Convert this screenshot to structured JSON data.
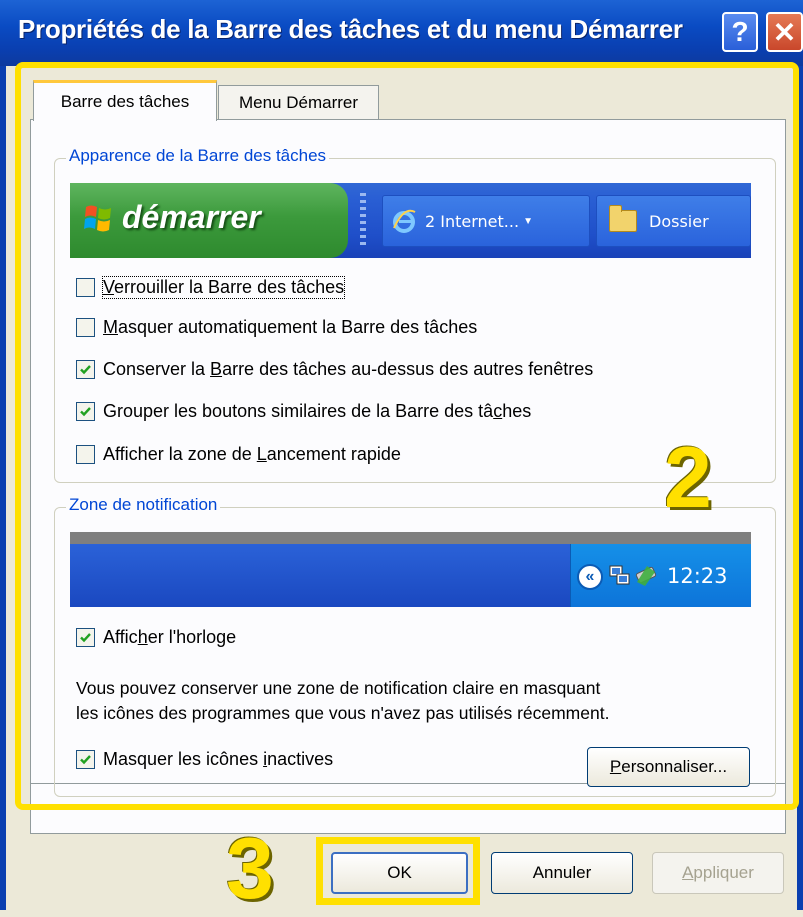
{
  "window": {
    "title": "Propriétés de la Barre des tâches et du menu Démarrer",
    "help_symbol": "?",
    "close_symbol": "✕"
  },
  "tabs": [
    {
      "label": "Barre des tâches",
      "selected": true
    },
    {
      "label": "Menu Démarrer",
      "selected": false
    }
  ],
  "appearance": {
    "legend": "Apparence de la Barre des tâches",
    "preview": {
      "start_label": "démarrer",
      "task_ie_label": "2 Internet...",
      "task_folder_label": "Dossier"
    },
    "options": [
      {
        "pre": "",
        "u": "V",
        "post": "errouiller la Barre des tâches",
        "checked": false
      },
      {
        "pre": "",
        "u": "M",
        "post": "asquer automatiquement la Barre des tâches",
        "checked": false
      },
      {
        "pre": "Conserver la ",
        "u": "B",
        "post": "arre des tâches au-dessus des autres fenêtres",
        "checked": true
      },
      {
        "pre": "Grouper les boutons similaires de la Barre des tâ",
        "u": "c",
        "post": "hes",
        "checked": true
      },
      {
        "pre": "Afficher la zone de ",
        "u": "L",
        "post": "ancement rapide",
        "checked": false
      }
    ]
  },
  "notification": {
    "legend": "Zone de notification",
    "clock_preview": "12:23",
    "show_clock": {
      "pre": "Affic",
      "u": "h",
      "post": "er l'horloge",
      "checked": true
    },
    "description_line1": "Vous pouvez conserver une zone de notification claire en masquant",
    "description_line2": "les icônes des programmes que vous n'avez pas utilisés récemment.",
    "hide_inactive": {
      "pre": "Masquer les icônes ",
      "u": "i",
      "post": "nactives",
      "checked": true
    },
    "customize_button": {
      "u": "P",
      "post": "ersonnaliser..."
    }
  },
  "buttons": {
    "ok": "OK",
    "cancel": "Annuler",
    "apply": {
      "u": "A",
      "post": "ppliquer"
    }
  },
  "annotations": {
    "marker_2": "2",
    "marker_3": "3",
    "highlight_color": "#ffe000"
  },
  "colors": {
    "titlebar": "#0a4bc3",
    "legend_text": "#0046d5",
    "start_button": "#3c9a3c",
    "taskbar": "#2a5fd4"
  }
}
